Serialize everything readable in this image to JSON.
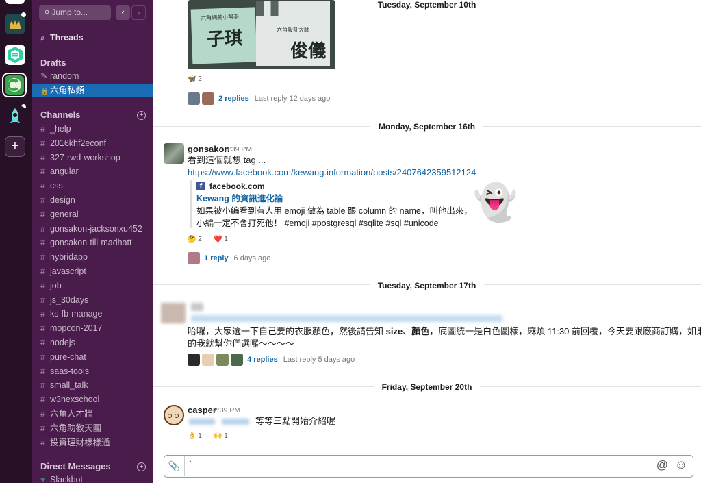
{
  "sidebar": {
    "jump_label": "Jump to...",
    "nav_back": "‹",
    "nav_forward": "›",
    "threads_label": "Threads",
    "drafts_header": "Drafts",
    "drafts": [
      {
        "prefix": "✎",
        "label": "random"
      },
      {
        "prefix": "🔒",
        "label": "六角私頻",
        "active": true
      }
    ],
    "channels_header": "Channels",
    "channels": [
      "_help",
      "2016khf2econf",
      "327-rwd-workshop",
      "angular",
      "css",
      "design",
      "general",
      "gonsakon-jacksonxu452",
      "gonsakon-till-madhatt",
      "hybridapp",
      "javascript",
      "job",
      "js_30days",
      "ks-fb-manage",
      "mopcon-2017",
      "nodejs",
      "pure-chat",
      "saas-tools",
      "small_talk",
      "w3hexschool",
      "六角人才牆",
      "六角助教天團",
      "投資理財樣樣通"
    ],
    "dm_header": "Direct Messages",
    "dm_first": "Slackbot"
  },
  "rail": {
    "add_label": "+"
  },
  "messages": {
    "top": {
      "date": "Tuesday, September 10th",
      "image_label_left_small": "六角網美小幫手",
      "image_label_left_big": "子琪",
      "image_label_right_small": "六角設計大師",
      "image_label_right_big": "俊儀",
      "reaction": {
        "emoji": "🦋",
        "count": "2"
      },
      "replies": "2 replies",
      "last_reply": "Last reply 12 days ago"
    },
    "gonsakon": {
      "date": "Monday, September 16th",
      "user": "gonsakon",
      "time": "3:39 PM",
      "text": "看到這個就想 tag ...",
      "link": "https://www.facebook.com/kewang.information/posts/2407642359512124",
      "preview_site": "facebook.com",
      "preview_title": "Kewang 的資訊進化論",
      "preview_line1": "如果被小編看到有人用 emoji 做為 table 跟 column 的 name，叫他出來，",
      "preview_line2": "小編一定不會打死他！ #emoji #postgresql #sqlite #sql #unicode",
      "ghost": "👻",
      "reactions": [
        {
          "emoji": "🤔",
          "count": "2"
        },
        {
          "emoji": "❤️",
          "count": "1"
        }
      ],
      "replies": "1 reply",
      "last_reply": "6 days ago"
    },
    "blurred": {
      "date": "Tuesday, September 17th",
      "text_line1_pre": "哈囉，大家選一下自己要的衣服顏色，然後請告知 ",
      "text_bold1": "size",
      "text_mid": "、",
      "text_bold2": "顏色",
      "text_line1_post": "，底圖統一是白色圖樣，麻煩 11:30 前回覆，今天要跟廠商訂購，如果沒有選",
      "text_line2": "的我就幫你們選囉～～～～",
      "replies": "4 replies",
      "last_reply": "Last reply 5 days ago"
    },
    "casper": {
      "date": "Friday, September 20th",
      "user": "casper",
      "time": "2:39 PM",
      "text": "等等三點開始介紹喔",
      "reactions": [
        {
          "emoji": "👌",
          "count": "1"
        },
        {
          "emoji": "🙌",
          "count": "1"
        }
      ]
    }
  },
  "composer": {
    "value": "`",
    "attach": "📎",
    "at": "@",
    "emoji": "☺"
  },
  "colors": {
    "sidebar": "#4a1c4c",
    "rail": "#261127",
    "active": "#1a6cb5",
    "link": "#1264a3"
  }
}
